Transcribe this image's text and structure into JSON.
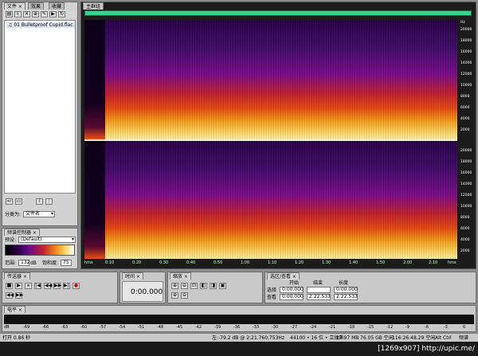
{
  "left_panel": {
    "tabs": [
      "文件 ×",
      "效果",
      "收藏"
    ],
    "file_item": "01 Bulletproof Cupid.flac",
    "sort_label": "分类为:",
    "sort_value": "文件名",
    "freq_panel_title": "频谱控制器 ×",
    "preset_label": "预设:",
    "preset_value": "(Default)",
    "range_label": "范围:",
    "range_value": "132",
    "range_unit": "dB",
    "saturation_label": "饱和度:",
    "saturation_value": "75"
  },
  "main": {
    "tab": "主群组",
    "freq_ticks_top": [
      "20000",
      "18000",
      "16000",
      "14000",
      "12000",
      "10000",
      "8000",
      "6000",
      "4000",
      "2000"
    ],
    "freq_ticks_bottom": [
      "20000",
      "18000",
      "16000",
      "14000",
      "12000",
      "10000",
      "8000",
      "6000",
      "4000",
      "2000"
    ],
    "hz_label": "Hz",
    "time_ticks": [
      "hms",
      "0:10",
      "0:20",
      "0:30",
      "0:40",
      "0:50",
      "1:00",
      "1:10",
      "1:20",
      "1:30",
      "1:40",
      "1:50",
      "2:00",
      "2:10",
      "hms"
    ]
  },
  "transport": {
    "title": "传送器 ×",
    "buttons": [
      "■",
      "▶",
      "⏸",
      "|◀",
      "◀◀",
      "▶▶",
      "▶|",
      "●",
      "◀◀",
      "▶▶"
    ]
  },
  "time": {
    "title": "时间 ×",
    "value": "0:00.000"
  },
  "zoom": {
    "title": "缩放 ×"
  },
  "selection": {
    "title": "选区/查看 ×",
    "headers": [
      "开始",
      "结束",
      "长度"
    ],
    "rows": [
      {
        "label": "选择",
        "start": "0:00.000",
        "end": "",
        "length": "0:00.000"
      },
      {
        "label": "查看",
        "start": "0:00.000",
        "end": "2:22.533",
        "length": "2:22.533"
      }
    ]
  },
  "levels": {
    "title": "电平 ×",
    "ticks": [
      "dB",
      "-69",
      "-66",
      "-63",
      "-60",
      "-57",
      "-54",
      "-51",
      "-48",
      "-45",
      "-42",
      "-39",
      "-36",
      "-33",
      "-30",
      "-27",
      "-24",
      "-21",
      "-18",
      "-15",
      "-12",
      "-9",
      "-6",
      "-3",
      "0"
    ]
  },
  "status": {
    "left": "打开 0.86 秒",
    "items": [
      "左:-79.2 dB @ 2:21.760,753Hz",
      "44100 • 16 位 • 立体声",
      "23.97 MB",
      "76.05 GB 空闲",
      "116:26:48.29 空闲",
      "Alt Ctrl",
      "频谱"
    ]
  },
  "watermark": "[1269x907] http://upic.me/"
}
